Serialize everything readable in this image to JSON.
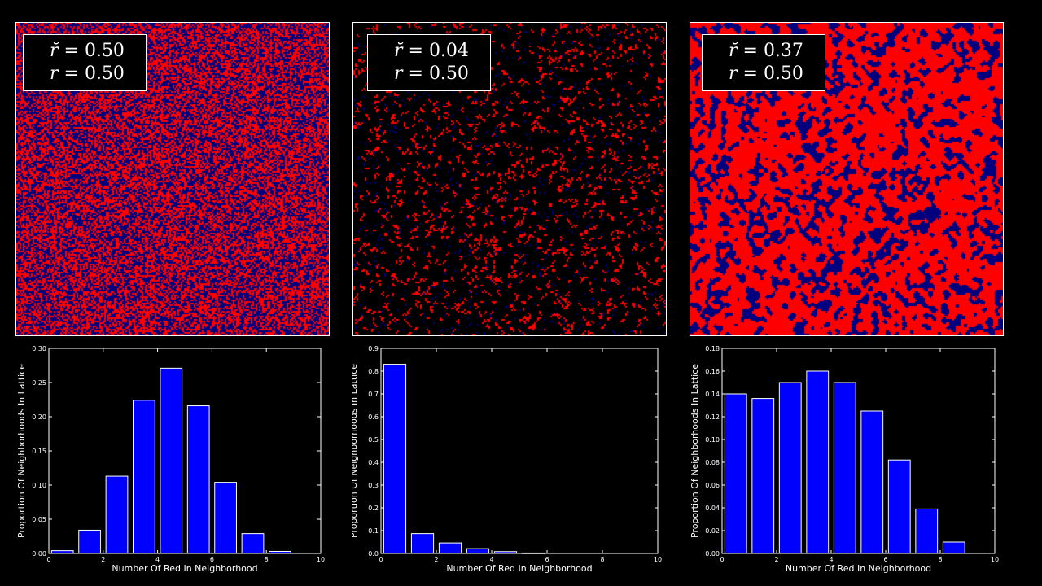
{
  "panels": [
    {
      "rtilde": "0.50",
      "r": "0.50",
      "red_fraction": 0.5,
      "blue_fraction": 0.5
    },
    {
      "rtilde": "0.04",
      "r": "0.50",
      "red_fraction": 0.04,
      "blue_fraction": 0.03
    },
    {
      "rtilde": "0.37",
      "r": "0.50",
      "red_fraction": 0.5,
      "blue_fraction": 0.5
    }
  ],
  "labels": {
    "rtilde_prefix": "r̆ = ",
    "r_prefix": "r = "
  },
  "colors": {
    "red": "#ff0000",
    "blue": "#00007f",
    "bar": "#0000ff"
  },
  "chart_data": [
    {
      "type": "bar",
      "xlabel": "Number Of Red In Neighborhood",
      "ylabel": "Proportion Of Neighborhoods In Lattice",
      "xlim": [
        0,
        10
      ],
      "ylim": [
        0,
        0.3
      ],
      "xticks": [
        0,
        2,
        4,
        6,
        8,
        10
      ],
      "yticks": [
        0,
        0.05,
        0.1,
        0.15,
        0.2,
        0.25,
        0.3
      ],
      "ytick_labels": [
        "0.00",
        "0.05",
        "0.10",
        "0.15",
        "0.20",
        "0.25",
        "0.30"
      ],
      "bins": [
        0,
        1,
        2,
        3,
        4,
        5,
        6,
        7,
        8
      ],
      "values": [
        0.004,
        0.034,
        0.113,
        0.224,
        0.271,
        0.216,
        0.104,
        0.029,
        0.003
      ]
    },
    {
      "type": "bar",
      "xlabel": "Number Of Red In Neighborhood",
      "ylabel": "Proportion Of Neighborhoods In Lattice",
      "xlim": [
        0,
        10
      ],
      "ylim": [
        0,
        0.9
      ],
      "xticks": [
        0,
        2,
        4,
        6,
        8,
        10
      ],
      "yticks": [
        0,
        0.1,
        0.2,
        0.3,
        0.4,
        0.5,
        0.6,
        0.7,
        0.8,
        0.9
      ],
      "ytick_labels": [
        "0.0",
        "0.1",
        "0.2",
        "0.3",
        "0.4",
        "0.5",
        "0.6",
        "0.7",
        "0.8",
        "0.9"
      ],
      "bins": [
        0,
        1,
        2,
        3,
        4,
        5,
        6,
        7,
        8
      ],
      "values": [
        0.83,
        0.087,
        0.046,
        0.021,
        0.008,
        0.002,
        0.0,
        0.0,
        0.0
      ]
    },
    {
      "type": "bar",
      "xlabel": "Number Of Red In Neighborhood",
      "ylabel": "Proportion Of Neighborhoods In Lattice",
      "xlim": [
        0,
        10
      ],
      "ylim": [
        0,
        0.18
      ],
      "xticks": [
        0,
        2,
        4,
        6,
        8,
        10
      ],
      "yticks": [
        0,
        0.02,
        0.04,
        0.06,
        0.08,
        0.1,
        0.12,
        0.14,
        0.16,
        0.18
      ],
      "ytick_labels": [
        "0.00",
        "0.02",
        "0.04",
        "0.06",
        "0.08",
        "0.10",
        "0.12",
        "0.14",
        "0.16",
        "0.18"
      ],
      "bins": [
        0,
        1,
        2,
        3,
        4,
        5,
        6,
        7,
        8
      ],
      "values": [
        0.14,
        0.136,
        0.15,
        0.16,
        0.15,
        0.125,
        0.082,
        0.039,
        0.01
      ]
    }
  ]
}
